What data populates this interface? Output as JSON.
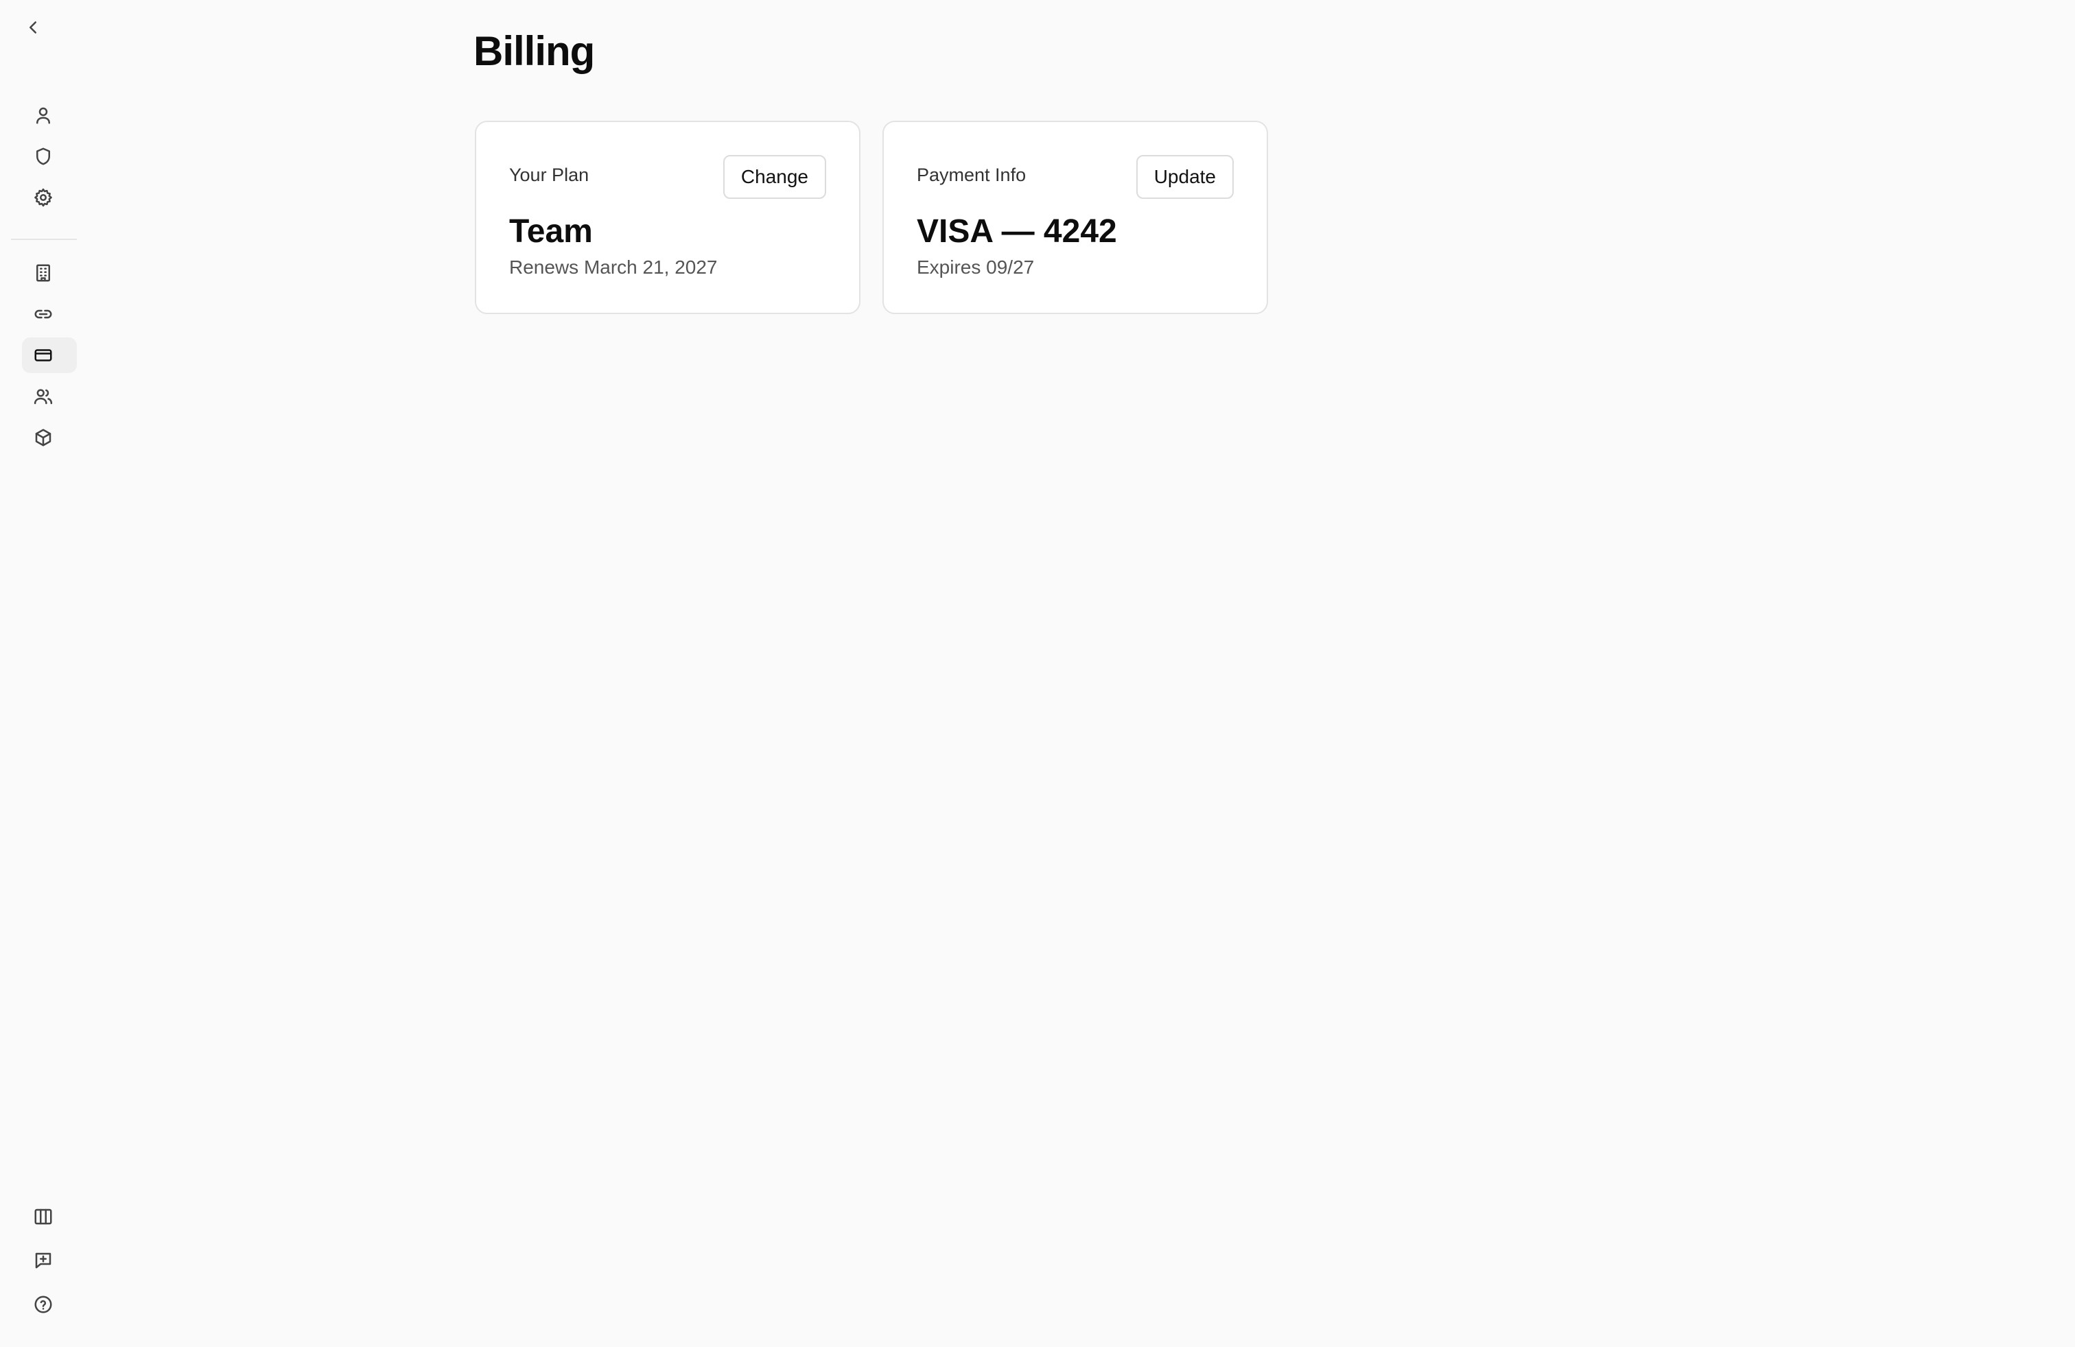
{
  "page": {
    "title": "Billing"
  },
  "sidebar": {
    "back": {
      "icon": "chevron-left-icon"
    },
    "top_items": [
      {
        "icon": "user-icon",
        "active": false
      },
      {
        "icon": "shield-icon",
        "active": false
      },
      {
        "icon": "gear-icon",
        "active": false
      }
    ],
    "middle_items": [
      {
        "icon": "building-icon",
        "active": false
      },
      {
        "icon": "link-icon",
        "active": false
      },
      {
        "icon": "credit-card-icon",
        "active": true
      },
      {
        "icon": "users-icon",
        "active": false
      },
      {
        "icon": "box-icon",
        "active": false
      }
    ],
    "bottom_items": [
      {
        "icon": "columns-icon",
        "active": false
      },
      {
        "icon": "message-plus-icon",
        "active": false
      },
      {
        "icon": "help-icon",
        "active": false
      }
    ]
  },
  "plan_card": {
    "label": "Your Plan",
    "action_label": "Change",
    "value": "Team",
    "subtext": "Renews March 21, 2027"
  },
  "payment_card": {
    "label": "Payment Info",
    "action_label": "Update",
    "value": "VISA — 4242",
    "subtext": "Expires 09/27"
  },
  "colors": {
    "background": "#fafafa",
    "card_background": "#ffffff",
    "card_border": "#e3e3e3",
    "active_nav": "#efefef"
  }
}
